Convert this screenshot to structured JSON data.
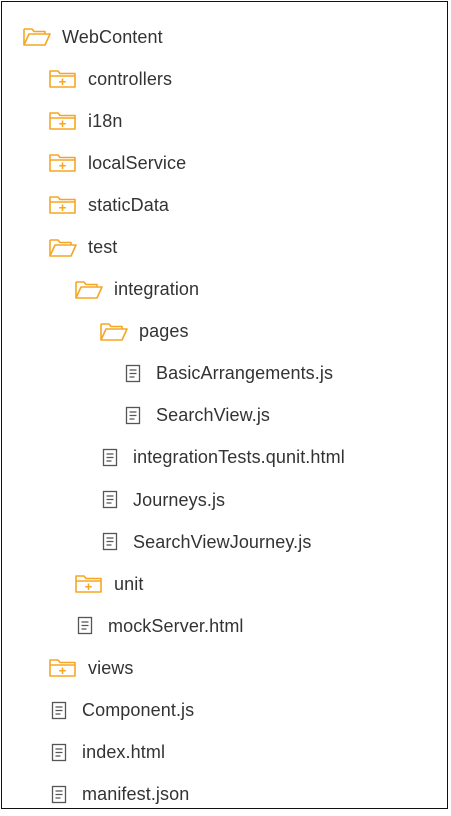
{
  "colors": {
    "folder": "#f5a623",
    "file": "#555555",
    "text": "#333333",
    "border": "#111111"
  },
  "tree": {
    "root": {
      "label": "WebContent",
      "icon": "folder-open-icon"
    },
    "controllers": {
      "label": "controllers",
      "icon": "folder-collapsed-icon"
    },
    "i18n": {
      "label": "i18n",
      "icon": "folder-collapsed-icon"
    },
    "localService": {
      "label": "localService",
      "icon": "folder-collapsed-icon"
    },
    "staticData": {
      "label": "staticData",
      "icon": "folder-collapsed-icon"
    },
    "test": {
      "label": "test",
      "icon": "folder-open-icon"
    },
    "integration": {
      "label": "integration",
      "icon": "folder-open-icon"
    },
    "pages": {
      "label": "pages",
      "icon": "folder-open-icon"
    },
    "basicArrangements": {
      "label": "BasicArrangements.js",
      "icon": "file-icon"
    },
    "searchView": {
      "label": "SearchView.js",
      "icon": "file-icon"
    },
    "integrationTests": {
      "label": "integrationTests.qunit.html",
      "icon": "file-icon"
    },
    "journeys": {
      "label": "Journeys.js",
      "icon": "file-icon"
    },
    "searchViewJourney": {
      "label": "SearchViewJourney.js",
      "icon": "file-icon"
    },
    "unit": {
      "label": "unit",
      "icon": "folder-collapsed-icon"
    },
    "mockServer": {
      "label": "mockServer.html",
      "icon": "file-icon"
    },
    "views": {
      "label": "views",
      "icon": "folder-collapsed-icon"
    },
    "component": {
      "label": "Component.js",
      "icon": "file-icon"
    },
    "index": {
      "label": "index.html",
      "icon": "file-icon"
    },
    "manifest": {
      "label": "manifest.json",
      "icon": "file-icon"
    }
  }
}
